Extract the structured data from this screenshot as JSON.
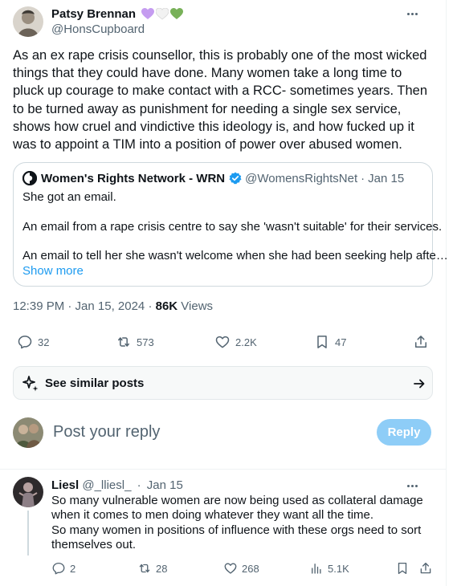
{
  "tweet": {
    "author": {
      "name": "Patsy Brennan",
      "handle": "@HonsCupboard",
      "avatar_icon": "profile-photo-icon",
      "emoji_hearts": [
        "#c59cf0",
        "#f2f2f2",
        "#78b159"
      ]
    },
    "text": "As an ex rape crisis counsellor, this is probably one of the most wicked things that they could have done. Many women take a long time to pluck up courage to make contact with a RCC- sometimes years. Then to be turned away as punishment for needing a single sex service, shows how cruel and vindictive this ideology is, and how fucked up it was to appoint a TIM into a position of power over abused women.",
    "quote": {
      "name": "Women's Rights Network - WRN",
      "handle": "@WomensRightsNet",
      "separator": "·",
      "date": "Jan 15",
      "lines": [
        "She got an email.",
        "An email from a rape crisis centre to say she 'wasn't suitable' for their services.",
        "An email to tell her she wasn't welcome when she had been seeking help afte…"
      ],
      "show_more": "Show more",
      "verified_color": "#1d9bf0"
    },
    "meta": {
      "time_date": "12:39 PM · Jan 15, 2024 · ",
      "views_count": "86K",
      "views_label": " Views"
    },
    "actions": {
      "replies": "32",
      "reposts": "573",
      "likes": "2.2K",
      "bookmarks": "47"
    },
    "see_similar": "See similar posts"
  },
  "composer": {
    "placeholder": "Post your reply",
    "button_label": "Reply",
    "button_color": "#8ecdf7"
  },
  "reply": {
    "name": "Liesl",
    "handle": "@_lliesl_",
    "separator": "·",
    "date": "Jan 15",
    "lines": [
      "So many vulnerable women are now being used as collateral damage when it comes to men doing whatever they want all the time.",
      "So many women in positions of influence with these orgs need to sort themselves out."
    ],
    "actions": {
      "replies": "2",
      "reposts": "28",
      "likes": "268",
      "views": "5.1K"
    }
  },
  "colors": {
    "accent": "#1d9bf0",
    "secondary_text": "#536471",
    "border": "#cfd9de"
  }
}
